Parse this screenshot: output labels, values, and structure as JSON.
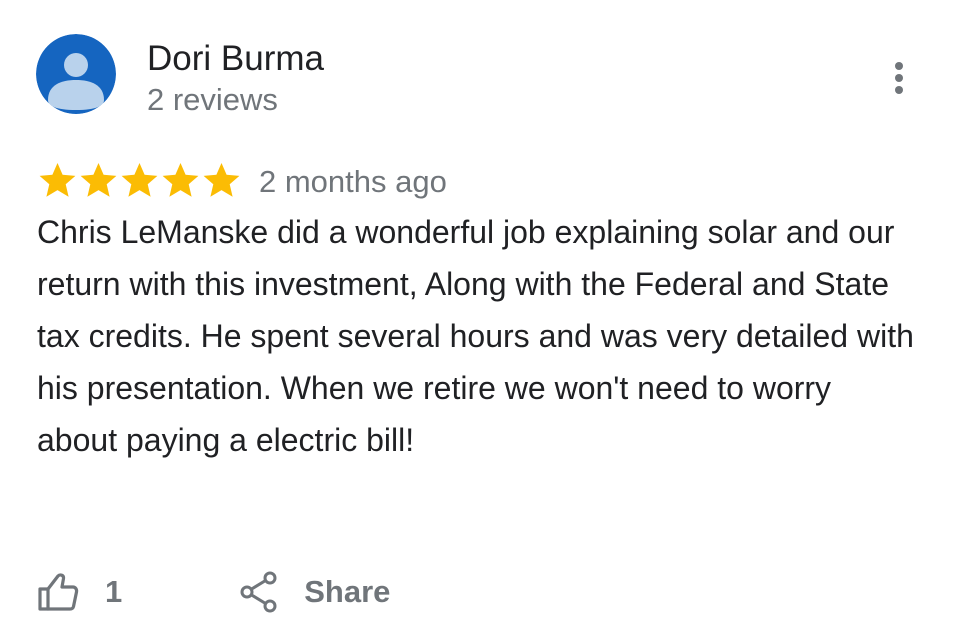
{
  "author": {
    "name": "Dori Burma",
    "meta": "2 reviews",
    "avatar_icon": "person-avatar-icon",
    "avatar_color": "#1565c0"
  },
  "menu": {
    "icon": "more-vertical-icon"
  },
  "rating": {
    "stars": 5,
    "max_stars": 5,
    "star_color": "#fbbc04",
    "date": "2 months ago"
  },
  "review": {
    "text": "Chris LeManske did a wonderful job explaining solar and our return with this investment, Along with the Federal and State tax credits. He spent several hours and was very detailed with his presentation. When we retire we won't need to worry about paying a electric bill!"
  },
  "actions": {
    "like_icon": "thumbs-up-icon",
    "like_count": "1",
    "share_icon": "share-icon",
    "share_label": "Share"
  }
}
